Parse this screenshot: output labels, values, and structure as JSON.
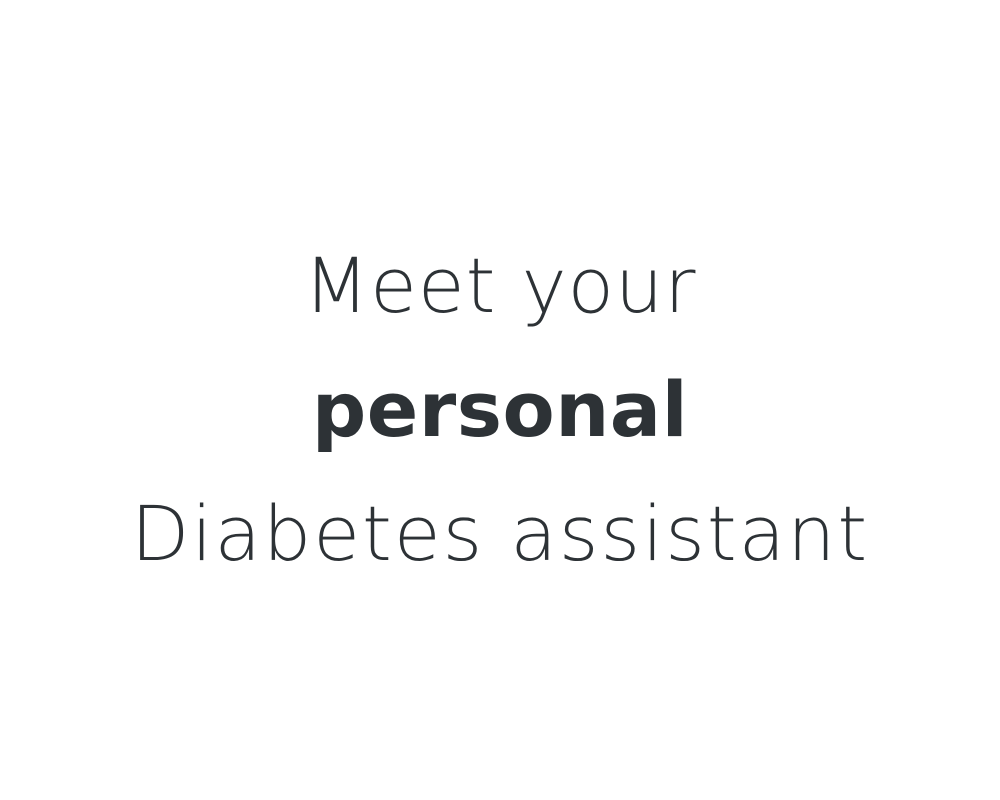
{
  "headline": {
    "line1": "Meet your",
    "line2": "personal",
    "line3": "Diabetes assistant"
  },
  "colors": {
    "text": "#2d3236",
    "background": "#ffffff"
  }
}
